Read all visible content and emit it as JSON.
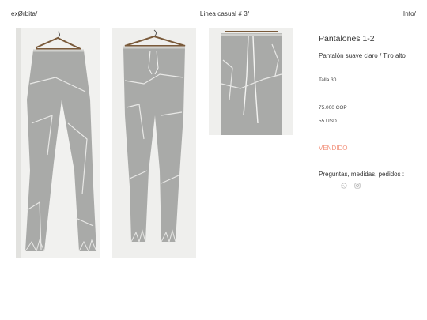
{
  "header": {
    "brand": "exØrbita/",
    "collection": "Linea casual # 3/",
    "info": "Info/"
  },
  "product": {
    "title": "Pantalones 1-2",
    "subtitle": "Pantalón suave claro / Tiro alto",
    "size": "Talla 30",
    "price_cop": "75.000 COP",
    "price_usd": "55 USD",
    "status": "VENDIDO",
    "status_color": "#f2917b"
  },
  "contact": {
    "prompt": "Preguntas, medidas, pedidos :",
    "icons": [
      "whatsapp-icon",
      "instagram-icon"
    ]
  },
  "colors": {
    "fabric": "#a9aaa8",
    "seam": "#e8e8e6",
    "background": "#efefed",
    "hanger": "#7a5a3a"
  }
}
